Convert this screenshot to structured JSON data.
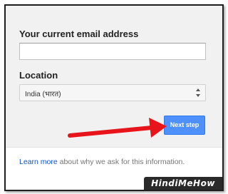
{
  "form": {
    "email_label": "Your current email address",
    "email_value": "",
    "email_placeholder": "",
    "location_label": "Location",
    "location_value": "India (भारत)",
    "next_button_label": "Next step"
  },
  "footer": {
    "link_text": "Learn more",
    "text": " about why we ask for this information."
  },
  "watermark": {
    "text": "HindiMeHow"
  },
  "icons": {
    "select_arrows": "up-down-arrows-icon",
    "annotation": "red-arrow-icon"
  },
  "colors": {
    "button_blue": "#4d90fe",
    "link_blue": "#1155cc",
    "annotation_red": "#e8141c"
  }
}
